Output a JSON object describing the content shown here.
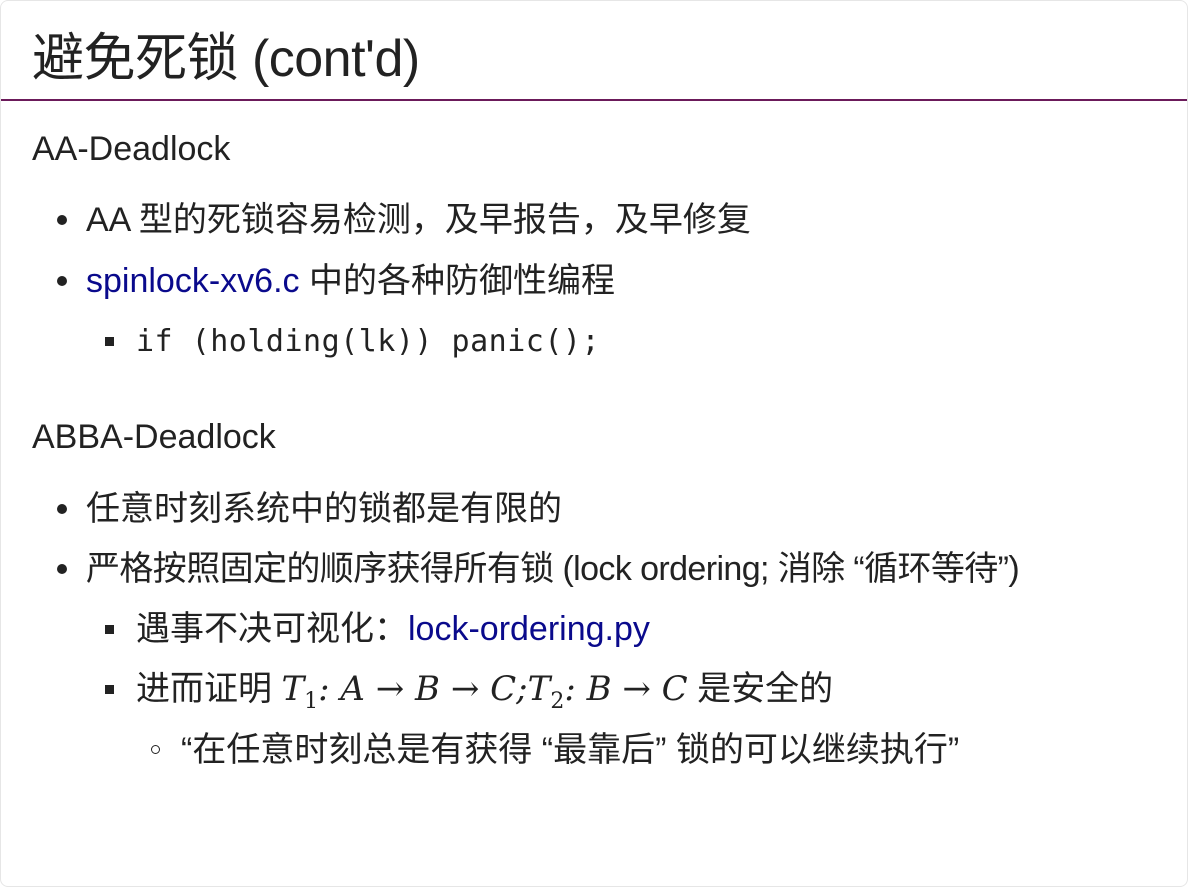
{
  "title": "避免死锁 (cont'd)",
  "colors": {
    "title_rule": "#6b1a5a",
    "link": "#0a0a8c",
    "text": "#222222"
  },
  "sections": [
    {
      "heading": "AA-Deadlock",
      "items": [
        {
          "text": "AA 型的死锁容易检测，及早报告，及早修复"
        },
        {
          "link": "spinlock-xv6.c",
          "text": " 中的各种防御性编程",
          "subitems": [
            {
              "code": "if (holding(lk)) panic();"
            }
          ]
        }
      ]
    },
    {
      "heading": "ABBA-Deadlock",
      "items": [
        {
          "text": "任意时刻系统中的锁都是有限的"
        },
        {
          "text": "严格按照固定的顺序获得所有锁 (lock ordering; 消除 “循环等待”)",
          "subitems": [
            {
              "text": "遇事不决可视化：",
              "link": "lock-ordering.py"
            },
            {
              "text_before": "进而证明 ",
              "math": {
                "t1": "T",
                "t1_sub": "1",
                "seq1": ": A → B → C;",
                "t2": "T",
                "t2_sub": "2",
                "seq2": ": B → C"
              },
              "text_after": " 是安全的",
              "subitems": [
                {
                  "text": "“在任意时刻总是有获得 “最靠后” 锁的可以继续执行”"
                }
              ]
            }
          ]
        }
      ]
    }
  ]
}
